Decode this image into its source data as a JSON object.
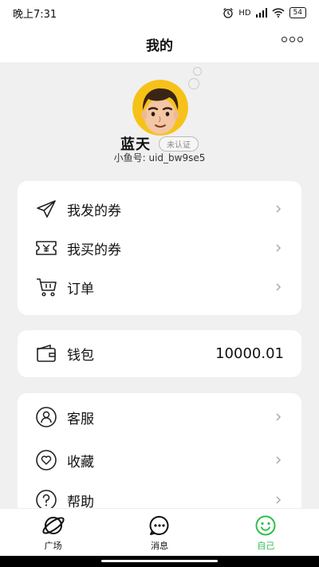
{
  "status_bar": {
    "time": "晚上7:31",
    "signal_label": "HD",
    "battery": "54"
  },
  "header": {
    "title": "我的",
    "more_icon": "more-dots-icon"
  },
  "profile": {
    "name": "蓝天",
    "verify_badge": "未认证",
    "uid": "小鱼号: uid_bw9se5",
    "avatar_bg": "#f6c218"
  },
  "menu_card": {
    "items": [
      {
        "label": "我发的券",
        "icon": "paper-plane-icon"
      },
      {
        "label": "我买的券",
        "icon": "yen-ticket-icon"
      },
      {
        "label": "订单",
        "icon": "cart-icon"
      }
    ]
  },
  "wallet": {
    "label": "钱包",
    "value": "10000.01",
    "icon": "wallet-icon"
  },
  "service_card": {
    "items": [
      {
        "label": "客服",
        "icon": "customer-service-icon"
      },
      {
        "label": "收藏",
        "icon": "heart-icon"
      },
      {
        "label": "帮助",
        "icon": "help-icon"
      }
    ]
  },
  "tabbar": {
    "tabs": [
      {
        "label": "广场",
        "icon": "planet-icon"
      },
      {
        "label": "消息",
        "icon": "chat-icon"
      },
      {
        "label": "自己",
        "icon": "smile-icon",
        "active": true
      }
    ],
    "active_color": "#2fbf4a"
  }
}
